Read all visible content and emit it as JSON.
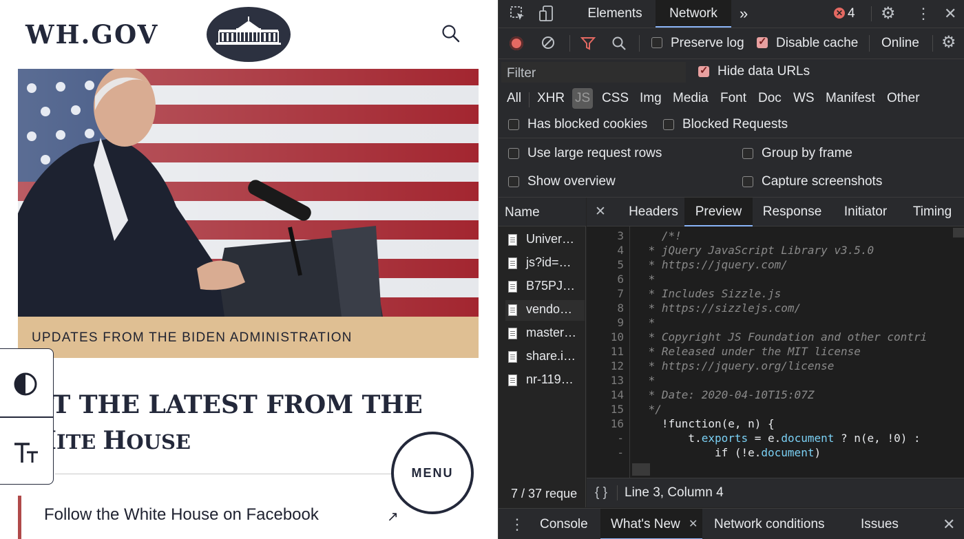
{
  "site": {
    "logo": "WH.GOV",
    "banner_label": "UPDATES FROM THE BIDEN ADMINISTRATION",
    "headline_line1": "ET THE LATEST FROM THE",
    "headline_line2_a": "H",
    "headline_line2_b": "ITE ",
    "headline_line2_c": "H",
    "headline_line2_d": "OUSE",
    "menu_label": "MENU",
    "social_link": "Follow the White House on Facebook",
    "icons": [
      "search-icon",
      "contrast-icon",
      "text-size-icon",
      "external-link-icon",
      "white-house-seal"
    ]
  },
  "devtools": {
    "tabs": [
      "Elements",
      "Network"
    ],
    "active_tab": "Network",
    "error_count": "4",
    "toolbar": {
      "preserve_log": "Preserve log",
      "disable_cache": "Disable cache",
      "throttle": "Online"
    },
    "filter": {
      "placeholder": "Filter",
      "hide_data_urls": "Hide data URLs",
      "types": [
        "All",
        "XHR",
        "JS",
        "CSS",
        "Img",
        "Media",
        "Font",
        "Doc",
        "WS",
        "Manifest",
        "Other"
      ],
      "selected_type": "JS",
      "has_blocked_cookies": "Has blocked cookies",
      "blocked_requests": "Blocked Requests",
      "large_rows": "Use large request rows",
      "group_by_frame": "Group by frame",
      "show_overview": "Show overview",
      "capture_screenshots": "Capture screenshots"
    },
    "name_header": "Name",
    "files": [
      "Univer…",
      "js?id=…",
      "B75PJ…",
      "vendo…",
      "master…",
      "share.i…",
      "nr-119…"
    ],
    "request_status": "7 / 37 reque",
    "detail_tabs": [
      "Headers",
      "Preview",
      "Response",
      "Initiator",
      "Timing"
    ],
    "active_detail_tab": "Preview",
    "code_lines": [
      {
        "n": "3",
        "t": "   /*!"
      },
      {
        "n": "4",
        "t": " * jQuery JavaScript Library v3.5.0"
      },
      {
        "n": "5",
        "t": " * https://jquery.com/"
      },
      {
        "n": "6",
        "t": " *"
      },
      {
        "n": "7",
        "t": " * Includes Sizzle.js"
      },
      {
        "n": "8",
        "t": " * https://sizzlejs.com/"
      },
      {
        "n": "9",
        "t": " *"
      },
      {
        "n": "10",
        "t": " * Copyright JS Foundation and other contri"
      },
      {
        "n": "11",
        "t": " * Released under the MIT license"
      },
      {
        "n": "12",
        "t": " * https://jquery.org/license"
      },
      {
        "n": "13",
        "t": " *"
      },
      {
        "n": "14",
        "t": " * Date: 2020-04-10T15:07Z"
      },
      {
        "n": "15",
        "t": " */"
      },
      {
        "n": "16",
        "t": "   !function(e, n) {"
      },
      {
        "n": "-",
        "t": "       t.exports = e.document ? n(e, !0) :"
      },
      {
        "n": "-",
        "t": "           if (!e.document)"
      }
    ],
    "pretty_print": "{ }",
    "cursor_position": "Line 3, Column 4",
    "drawer_tabs": [
      "Console",
      "What's New",
      "Network conditions",
      "Issues"
    ],
    "active_drawer_tab": "What's New"
  }
}
